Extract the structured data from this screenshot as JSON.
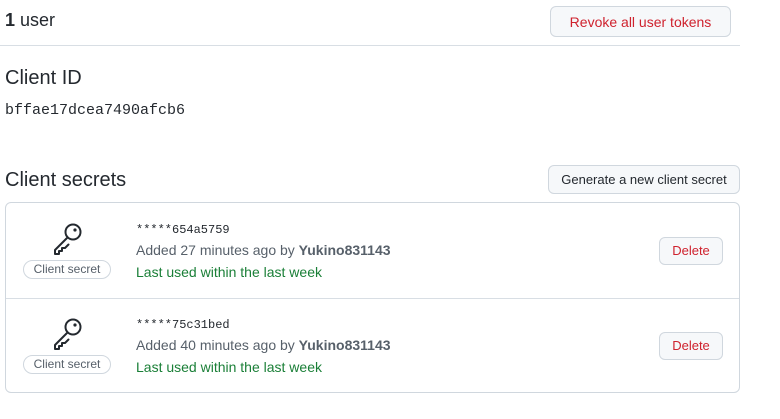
{
  "users": {
    "count": "1",
    "label": " user",
    "revoke_label": "Revoke all user tokens"
  },
  "client_id": {
    "title": "Client ID",
    "value": "bffae17dcea7490afcb6"
  },
  "client_secrets": {
    "title": "Client secrets",
    "generate_label": "Generate a new client secret",
    "items": [
      {
        "icon": "key-icon",
        "badge": "Client secret",
        "masked": "*****654a5759",
        "added_prefix": "Added 27 minutes ago by ",
        "author": "Yukino831143",
        "last_used": "Last used within the last week",
        "delete_label": "Delete"
      },
      {
        "icon": "key-icon",
        "badge": "Client secret",
        "masked": "*****75c31bed",
        "added_prefix": "Added 40 minutes ago by ",
        "author": "Yukino831143",
        "last_used": "Last used within the last week",
        "delete_label": "Delete"
      }
    ]
  },
  "colors": {
    "danger": "#cf222e",
    "success": "#1a7f37",
    "muted": "#57606a",
    "border": "#d0d7de"
  }
}
